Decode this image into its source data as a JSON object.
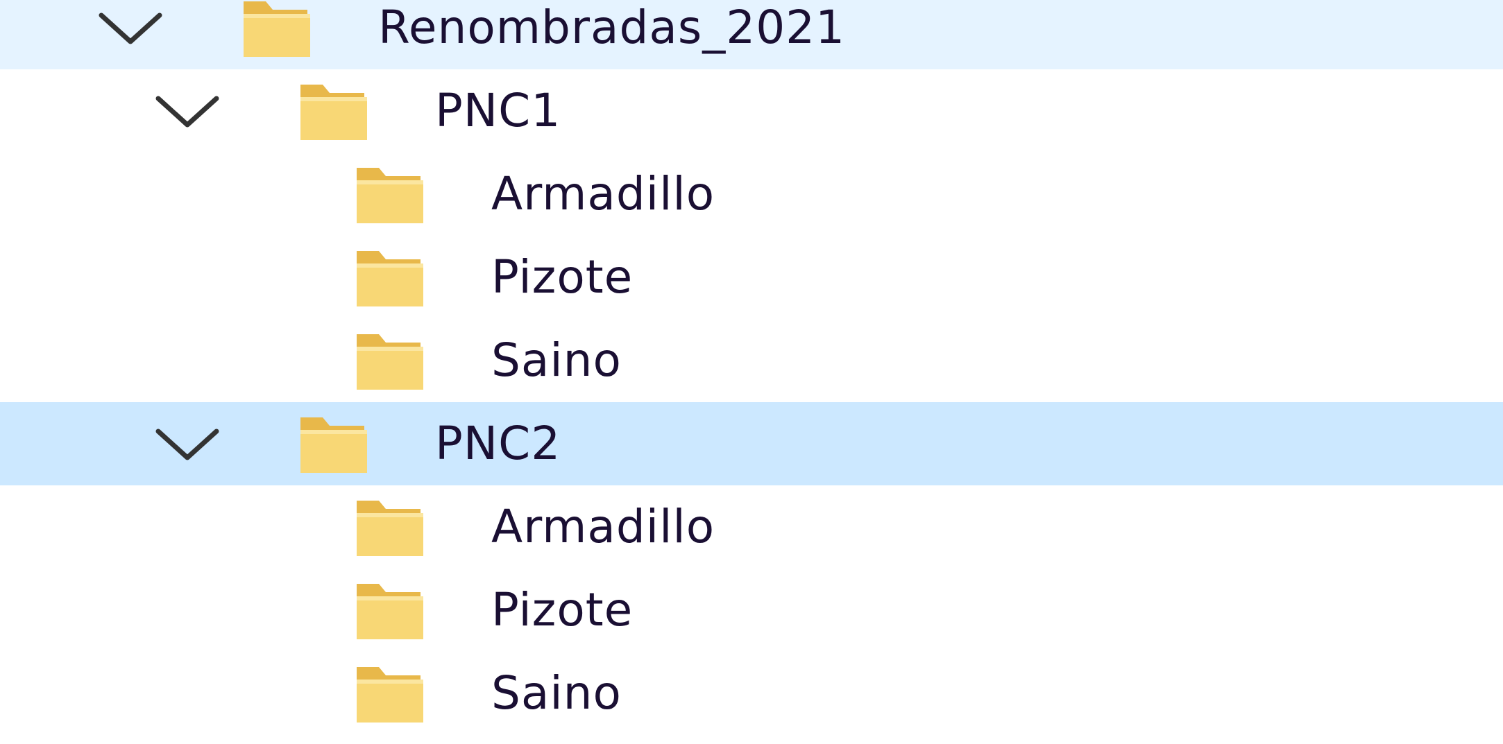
{
  "tree": {
    "nodes": [
      {
        "label": "Renombradas_2021",
        "level": 0,
        "expanded": true,
        "selected": false,
        "has_children": true
      },
      {
        "label": "PNC1",
        "level": 1,
        "expanded": true,
        "selected": false,
        "has_children": true
      },
      {
        "label": "Armadillo",
        "level": 2,
        "expanded": false,
        "selected": false,
        "has_children": false
      },
      {
        "label": "Pizote",
        "level": 2,
        "expanded": false,
        "selected": false,
        "has_children": false
      },
      {
        "label": "Saino",
        "level": 2,
        "expanded": false,
        "selected": false,
        "has_children": false
      },
      {
        "label": "PNC2",
        "level": 1,
        "expanded": true,
        "selected": true,
        "has_children": true
      },
      {
        "label": "Armadillo",
        "level": 2,
        "expanded": false,
        "selected": false,
        "has_children": false
      },
      {
        "label": "Pizote",
        "level": 2,
        "expanded": false,
        "selected": false,
        "has_children": false
      },
      {
        "label": "Saino",
        "level": 2,
        "expanded": false,
        "selected": false,
        "has_children": false
      }
    ]
  },
  "icons": {
    "expander": "chevron-down-icon",
    "folder": "folder-icon"
  },
  "colors": {
    "selection_background": "#cce8ff",
    "folder_body": "#f8d775",
    "folder_back": "#e8b84a",
    "chevron": "#333333",
    "text": "#1a0f33"
  }
}
